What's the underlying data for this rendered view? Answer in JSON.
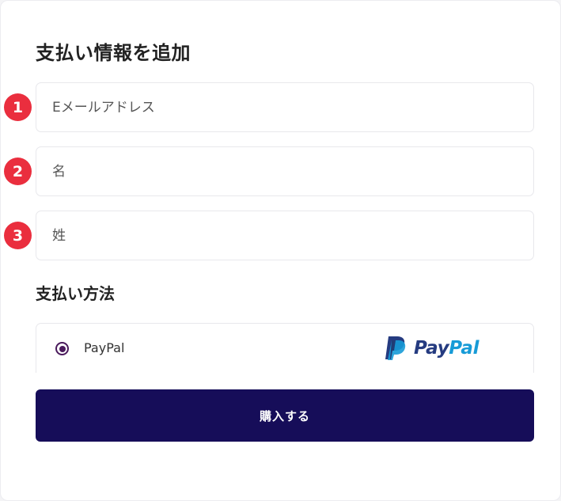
{
  "form": {
    "title": "支払い情報を追加",
    "fields": [
      {
        "marker": "1",
        "placeholder": "Eメールアドレス",
        "value": ""
      },
      {
        "marker": "2",
        "placeholder": "名",
        "value": ""
      },
      {
        "marker": "3",
        "placeholder": "姓",
        "value": ""
      }
    ]
  },
  "payment": {
    "section_title": "支払い方法",
    "option_label": "PayPal",
    "selected": true,
    "logo": {
      "pay": "Pay",
      "pal": "Pal",
      "icon": "paypal-icon"
    }
  },
  "submit": {
    "label": "購入する"
  },
  "colors": {
    "badge": "#ea2e3e",
    "button_bg": "#160d59",
    "radio": "#4a1a5c",
    "paypal_dark": "#253b80",
    "paypal_light": "#179bd7"
  }
}
